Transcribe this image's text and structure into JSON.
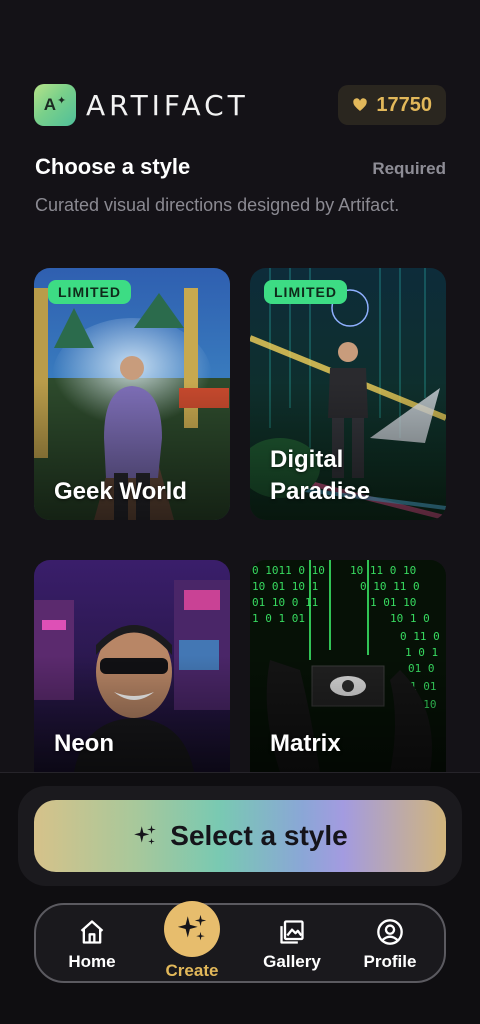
{
  "app": {
    "brand_name": "ARTIFACT",
    "logo_mark": "A",
    "credits": "17750",
    "accent_color": "#e2b85a",
    "limited_color": "#3ddc84"
  },
  "section": {
    "title": "Choose a style",
    "required": "Required",
    "subtitle": "Curated visual directions designed by Artifact."
  },
  "styles": [
    {
      "name": "Geek World",
      "badge": "LIMITED"
    },
    {
      "name": "Digital Paradise",
      "badge": "LIMITED"
    },
    {
      "name": "Neon",
      "badge": ""
    },
    {
      "name": "Matrix",
      "badge": ""
    }
  ],
  "cta": {
    "label": "Select a style",
    "icon": "sparkle-icon"
  },
  "nav": {
    "items": [
      {
        "label": "Home",
        "icon": "home-icon"
      },
      {
        "label": "Create",
        "icon": "sparkle-icon"
      },
      {
        "label": "Gallery",
        "icon": "gallery-icon"
      },
      {
        "label": "Profile",
        "icon": "profile-icon"
      }
    ],
    "active": "Create"
  }
}
